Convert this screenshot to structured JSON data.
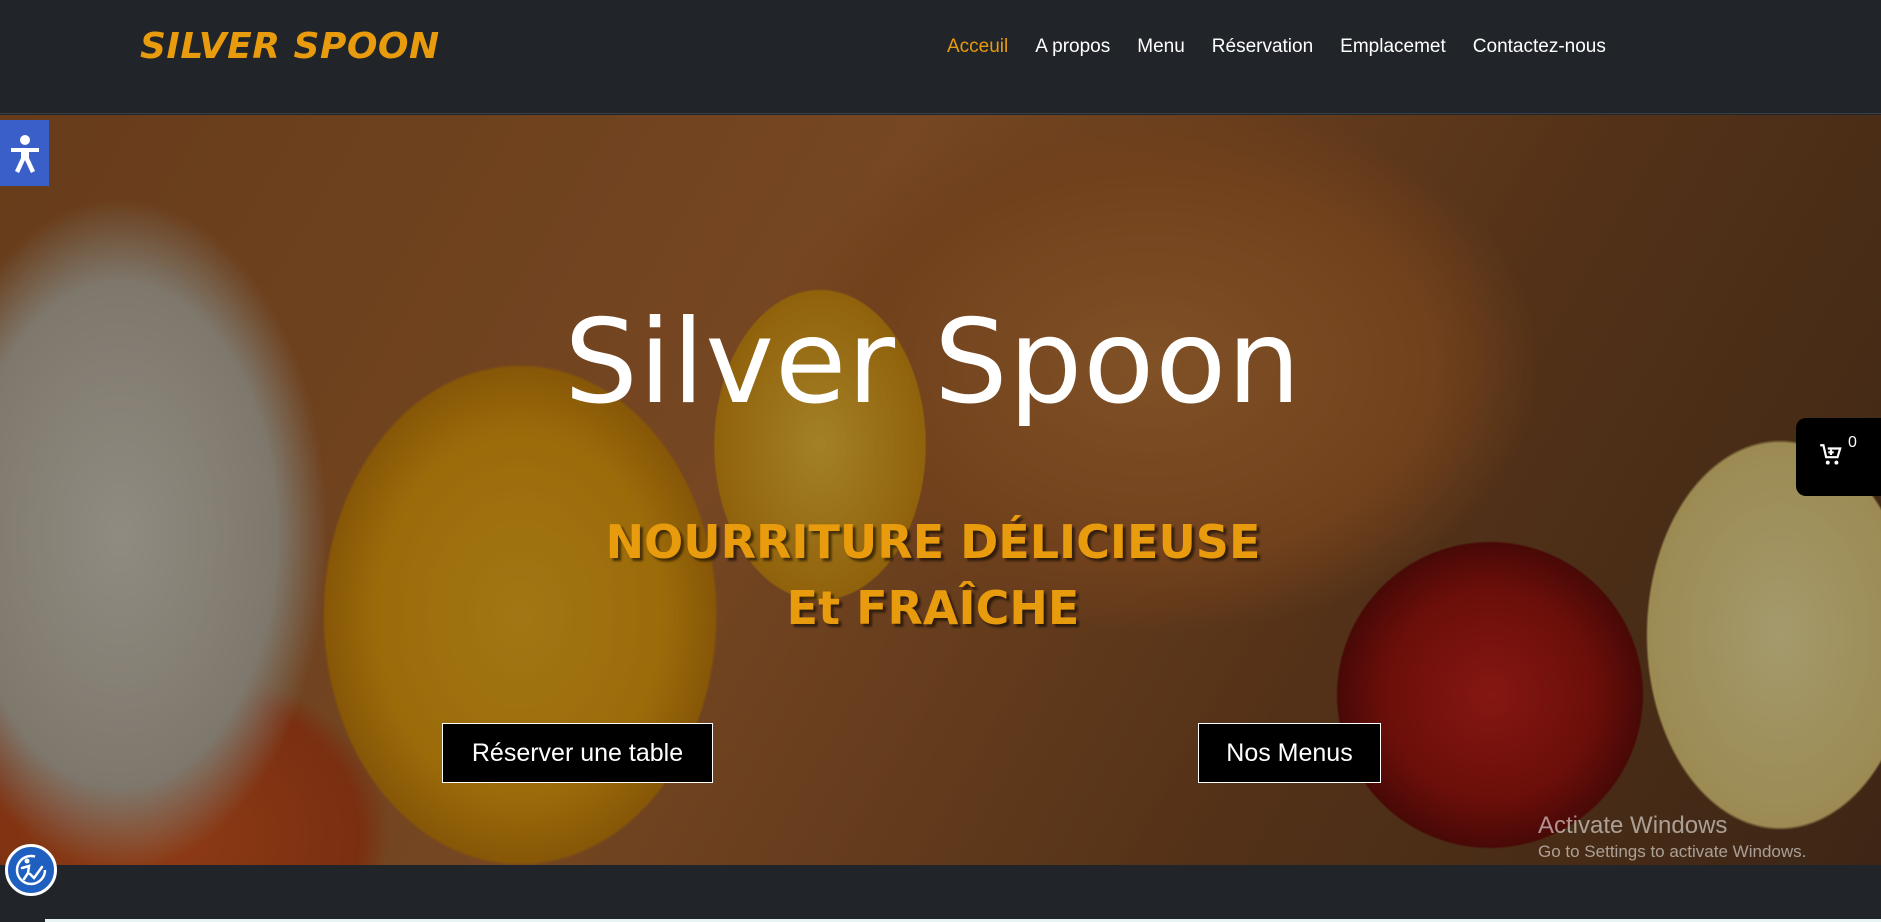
{
  "header": {
    "brand": "SILVER SPOON",
    "nav": [
      {
        "label": "Acceuil",
        "active": true
      },
      {
        "label": "A propos"
      },
      {
        "label": "Menu"
      },
      {
        "label": "Réservation"
      },
      {
        "label": "Emplacemet"
      },
      {
        "label": "Contactez-nous"
      }
    ]
  },
  "hero": {
    "title": "Silver Spoon",
    "subtitle_line1": "NOURRITURE DÉLICIEUSE",
    "subtitle_line2": "Et FRAÎCHE",
    "reserve_button": "Réserver une table",
    "menus_button": "Nos Menus"
  },
  "cart": {
    "icon": "cart-icon",
    "count": "0"
  },
  "accessibility": {
    "icon": "accessibility-icon",
    "widget_icon": "accessibility-check-icon"
  },
  "watermark": {
    "line1": "Activate Windows",
    "line2": "Go to Settings to activate Windows."
  },
  "colors": {
    "accent": "#e89b0c",
    "navbar": "#212529",
    "accessibility_blue": "#3a5fc8"
  }
}
